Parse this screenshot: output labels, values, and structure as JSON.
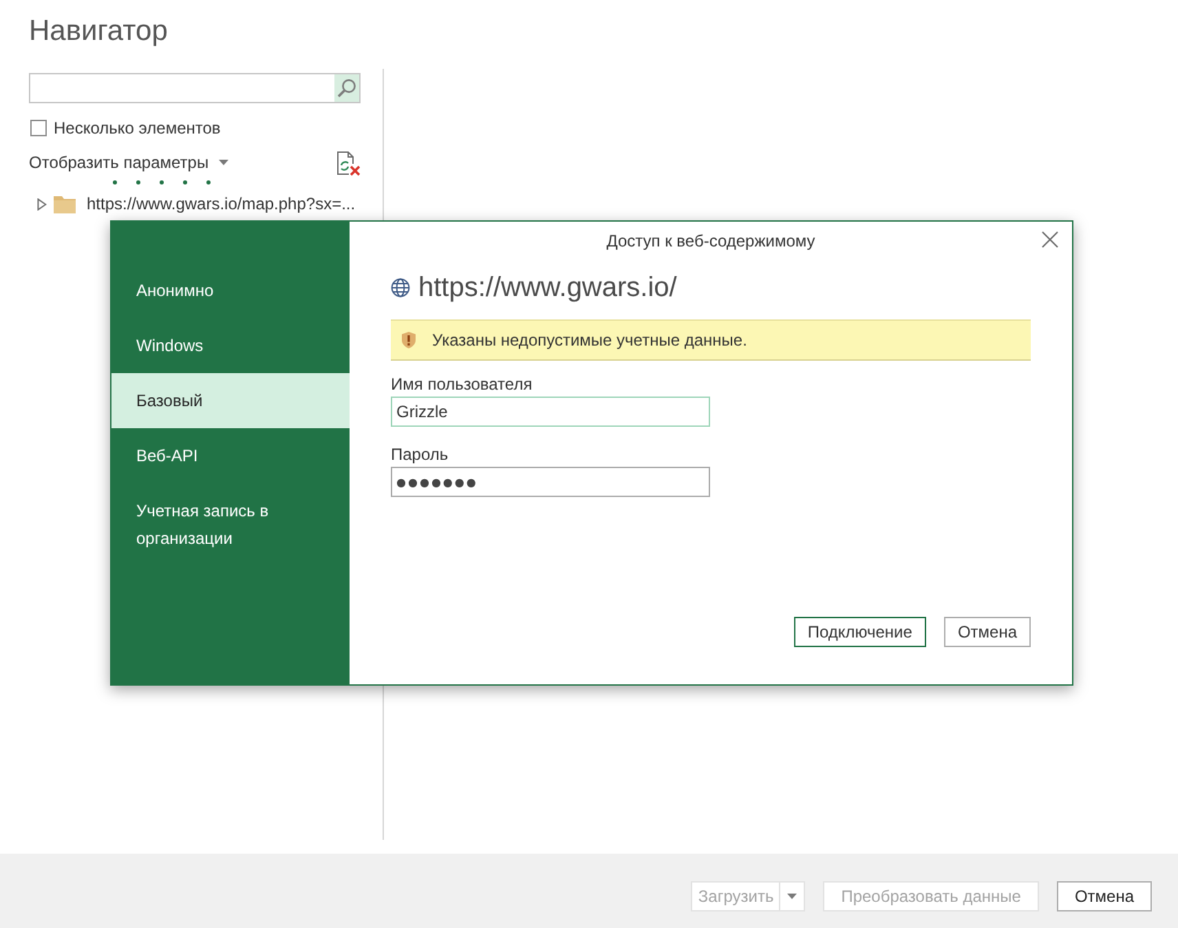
{
  "navigator": {
    "title": "Навигатор",
    "multi_select": {
      "label": "Несколько элементов",
      "checked": false
    },
    "display_options": {
      "label": "Отобразить параметры"
    },
    "loading": true,
    "tree": [
      {
        "label": "https://www.gwars.io/map.php?sx=...",
        "expanded": false
      }
    ]
  },
  "dialog": {
    "title": "Доступ к веб-содержимому",
    "auth_methods": [
      {
        "label": "Анонимно",
        "selected": false
      },
      {
        "label": "Windows",
        "selected": false
      },
      {
        "label": "Базовый",
        "selected": true
      },
      {
        "label": "Веб-API",
        "selected": false
      },
      {
        "label": "Учетная запись в организации",
        "selected": false
      }
    ],
    "url": "https://www.gwars.io/",
    "warning": "Указаны недопустимые учетные данные.",
    "fields": [
      {
        "kind": "text",
        "label": "Имя пользователя",
        "value": "Grizzle",
        "focused": true
      },
      {
        "kind": "password",
        "label": "Пароль",
        "value": "●●●●●●●",
        "focused": false
      }
    ],
    "buttons": [
      {
        "label": "Подключение",
        "default": true
      },
      {
        "label": "Отмена",
        "default": false
      }
    ]
  },
  "footer": {
    "buttons": [
      {
        "kind": "split",
        "label": "Загрузить",
        "disabled": true
      },
      {
        "kind": "plain",
        "label": "Преобразовать данные",
        "disabled": true
      },
      {
        "kind": "plain",
        "label": "Отмена",
        "disabled": false
      }
    ]
  }
}
